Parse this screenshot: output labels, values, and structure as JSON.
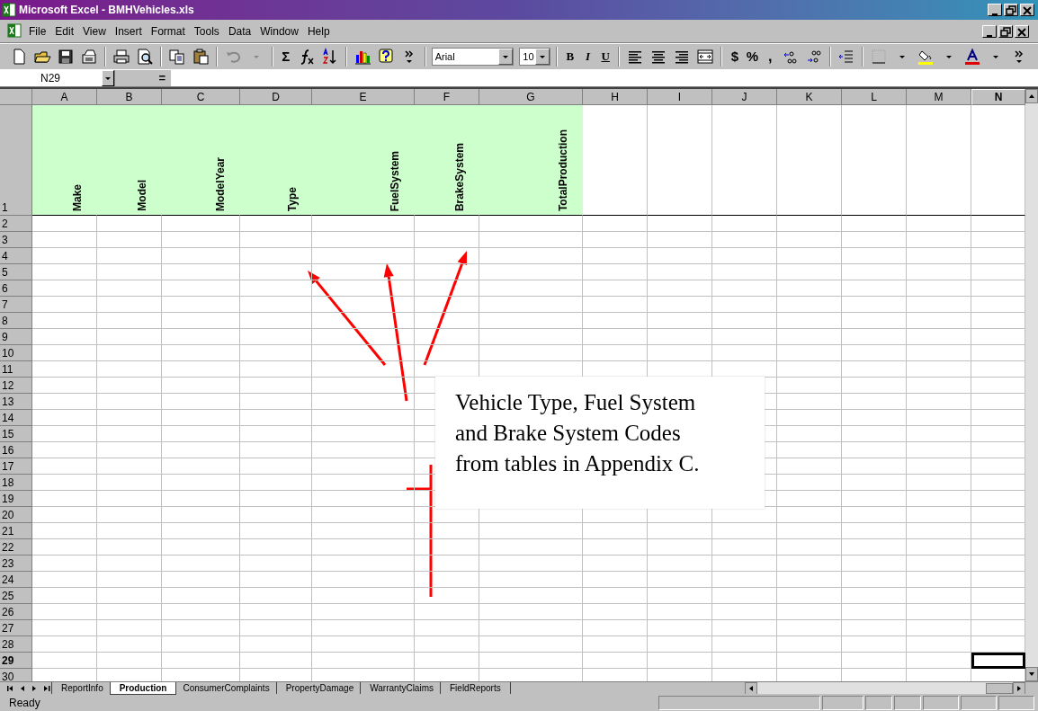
{
  "window": {
    "title": "Microsoft Excel - BMHVehicles.xls"
  },
  "menu": [
    "File",
    "Edit",
    "View",
    "Insert",
    "Format",
    "Tools",
    "Data",
    "Window",
    "Help"
  ],
  "toolbar": {
    "sum": "Σ",
    "font": "Arial",
    "size": "10",
    "bold": "B",
    "italic": "I",
    "underline": "U",
    "currency": "$",
    "percent": "%",
    "comma": ","
  },
  "formula_bar": {
    "name_box": "N29",
    "equals": "="
  },
  "columns": [
    {
      "label": "A",
      "selected": false
    },
    {
      "label": "B",
      "selected": false
    },
    {
      "label": "C",
      "selected": false
    },
    {
      "label": "D",
      "selected": false
    },
    {
      "label": "E",
      "selected": false
    },
    {
      "label": "F",
      "selected": false
    },
    {
      "label": "G",
      "selected": false
    },
    {
      "label": "H",
      "selected": false
    },
    {
      "label": "I",
      "selected": false
    },
    {
      "label": "J",
      "selected": false
    },
    {
      "label": "K",
      "selected": false
    },
    {
      "label": "L",
      "selected": false
    },
    {
      "label": "M",
      "selected": false
    },
    {
      "label": "N",
      "selected": true
    }
  ],
  "rows": [
    {
      "label": "1",
      "selected": false,
      "cells": [
        "Make",
        "Model",
        "ModelYear",
        "Type",
        "FuelSystem",
        "BrakeSystem",
        "TotalProduction"
      ]
    },
    {
      "label": "2",
      "selected": false
    },
    {
      "label": "3",
      "selected": false
    },
    {
      "label": "4",
      "selected": false
    },
    {
      "label": "5",
      "selected": false
    },
    {
      "label": "6",
      "selected": false
    },
    {
      "label": "7",
      "selected": false
    },
    {
      "label": "8",
      "selected": false
    },
    {
      "label": "9",
      "selected": false
    },
    {
      "label": "10",
      "selected": false
    },
    {
      "label": "11",
      "selected": false
    },
    {
      "label": "12",
      "selected": false
    },
    {
      "label": "13",
      "selected": false
    },
    {
      "label": "14",
      "selected": false
    },
    {
      "label": "15",
      "selected": false
    },
    {
      "label": "16",
      "selected": false
    },
    {
      "label": "17",
      "selected": false
    },
    {
      "label": "18",
      "selected": false
    },
    {
      "label": "19",
      "selected": false
    },
    {
      "label": "20",
      "selected": false
    },
    {
      "label": "21",
      "selected": false
    },
    {
      "label": "22",
      "selected": false
    },
    {
      "label": "23",
      "selected": false
    },
    {
      "label": "24",
      "selected": false
    },
    {
      "label": "25",
      "selected": false
    },
    {
      "label": "26",
      "selected": false
    },
    {
      "label": "27",
      "selected": false
    },
    {
      "label": "28",
      "selected": false
    },
    {
      "label": "29",
      "selected": true
    },
    {
      "label": "30",
      "selected": false
    }
  ],
  "callout": {
    "lines": [
      "Vehicle Type, Fuel System",
      "and Brake System Codes",
      "from tables in Appendix C."
    ]
  },
  "sheet_tabs": [
    {
      "label": "ReportInfo",
      "selected": false
    },
    {
      "label": "Production",
      "selected": true
    },
    {
      "label": "ConsumerComplaints",
      "selected": false
    },
    {
      "label": "PropertyDamage",
      "selected": false
    },
    {
      "label": "WarrantyClaims",
      "selected": false
    },
    {
      "label": "FieldReports",
      "selected": false
    }
  ],
  "status_bar": {
    "text": "Ready"
  }
}
